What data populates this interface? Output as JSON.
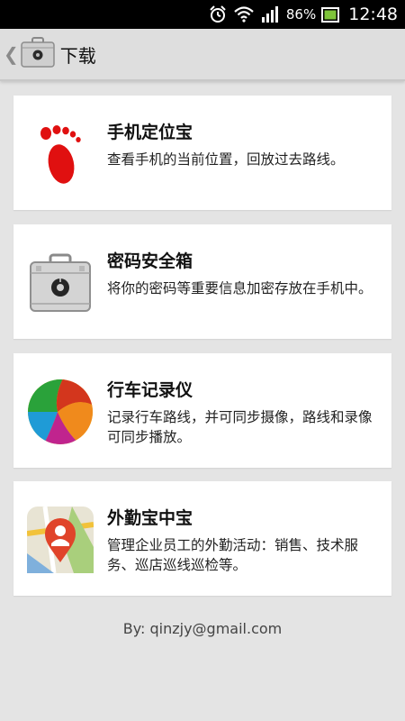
{
  "status_bar": {
    "battery_percent": "86%",
    "time": "12:48",
    "icons": [
      "alarm-icon",
      "wifi-icon",
      "signal-icon",
      "battery-icon"
    ]
  },
  "action_bar": {
    "title": "下载",
    "app_icon": "briefcase-icon"
  },
  "apps": [
    {
      "title": "手机定位宝",
      "description": "查看手机的当前位置，回放过去路线。",
      "icon": "footprint-icon"
    },
    {
      "title": "密码安全箱",
      "description": "将你的密码等重要信息加密存放在手机中。",
      "icon": "safe-icon"
    },
    {
      "title": "行车记录仪",
      "description": "记录行车路线，并可同步摄像，路线和录像可同步播放。",
      "icon": "color-ball-icon"
    },
    {
      "title": "外勤宝中宝",
      "description": "管理企业员工的外勤活动：销售、技术服务、巡店巡线巡检等。",
      "icon": "map-pin-icon"
    }
  ],
  "footer": {
    "text": "By: qinzjy@gmail.com"
  },
  "colors": {
    "background": "#e4e4e4",
    "card": "#ffffff",
    "status_bar": "#000000",
    "action_bar": "#dedede"
  }
}
